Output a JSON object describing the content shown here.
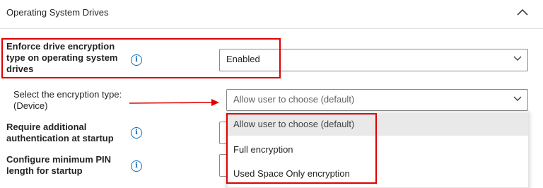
{
  "section": {
    "title": "Operating System Drives"
  },
  "settings": {
    "enforce_type": {
      "label": "Enforce drive encryption type on operating system drives",
      "value": "Enabled"
    },
    "encryption_type": {
      "label_line1": "Select the encryption type:",
      "label_line2": "(Device)",
      "value": "Allow user to choose (default)",
      "options": [
        "Allow user to choose (default)",
        "Full encryption",
        "Used Space Only encryption"
      ]
    },
    "additional_auth": {
      "label_line1": "Require additional",
      "label_line2": "authentication at startup"
    },
    "min_pin": {
      "label_line1": "Configure minimum PIN",
      "label_line2": "length for startup"
    }
  },
  "icons": {
    "info": "i",
    "collapse": "chevron-up-icon",
    "dropdown": "chevron-down-icon"
  },
  "colors": {
    "highlight": "#e00000",
    "info": "#0f6cbd"
  }
}
